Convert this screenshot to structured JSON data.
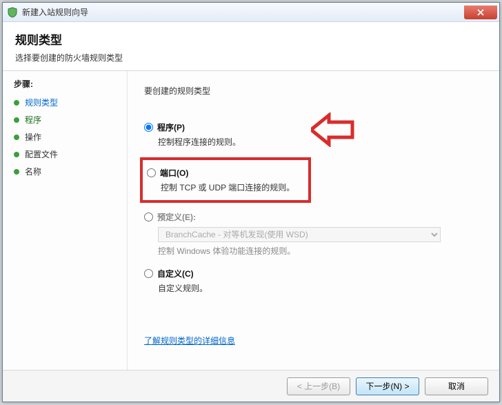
{
  "window": {
    "title": "新建入站规则向导"
  },
  "header": {
    "title": "规则类型",
    "subtitle": "选择要创建的防火墙规则类型"
  },
  "sidebar": {
    "steps_title": "步骤:",
    "items": [
      {
        "label": "规则类型"
      },
      {
        "label": "程序"
      },
      {
        "label": "操作"
      },
      {
        "label": "配置文件"
      },
      {
        "label": "名称"
      }
    ]
  },
  "main": {
    "prompt": "要创建的规则类型",
    "options": {
      "program": {
        "label": "程序(P)",
        "desc": "控制程序连接的规则。"
      },
      "port": {
        "label": "端口(O)",
        "desc": "控制 TCP 或 UDP 端口连接的规则。"
      },
      "predefined": {
        "label": "预定义(E):",
        "selected": "BranchCache - 对等机发现(使用 WSD)",
        "desc": "控制 Windows 体验功能连接的规则。"
      },
      "custom": {
        "label": "自定义(C)",
        "desc": "自定义规则。"
      }
    },
    "learn_more": "了解规则类型的详细信息"
  },
  "footer": {
    "back": "< 上一步(B)",
    "next": "下一步(N) >",
    "cancel": "取消"
  }
}
